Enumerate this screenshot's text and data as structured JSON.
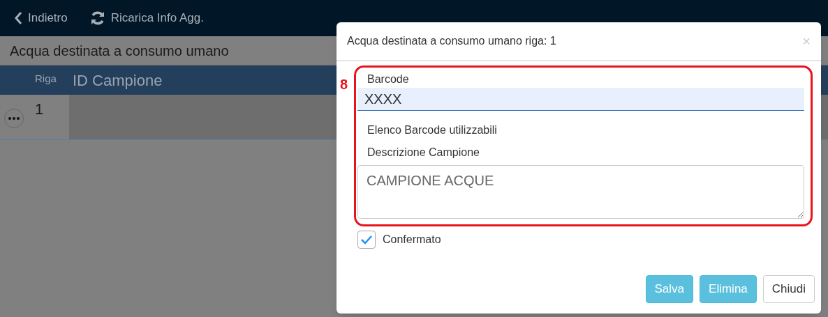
{
  "toolbar": {
    "items": [
      {
        "kind": "back",
        "label": "Indietro"
      },
      {
        "kind": "reload",
        "label": "Ricarica Info Agg."
      }
    ]
  },
  "page_title": "Acqua destinata a consumo umano",
  "table": {
    "columns": [
      "Riga",
      "ID Campione"
    ],
    "rows": [
      {
        "riga": "1",
        "id_campione": ""
      }
    ]
  },
  "dialog": {
    "title": "Acqua destinata a consumo umano riga: 1",
    "close": "×",
    "annotation": {
      "label": "8"
    },
    "barcode": {
      "label": "Barcode",
      "value": "XXXX"
    },
    "barcode_list_label": "Elenco Barcode utilizzabili",
    "description": {
      "label": "Descrizione Campione",
      "placeholder": "CAMPIONE ACQUE"
    },
    "confirmed": {
      "label": "Confermato",
      "checked": true
    },
    "buttons": [
      {
        "kind": "primary",
        "label": "Salva"
      },
      {
        "kind": "primary",
        "label": "Elimina"
      },
      {
        "kind": "default",
        "label": "Chiudi"
      }
    ]
  }
}
